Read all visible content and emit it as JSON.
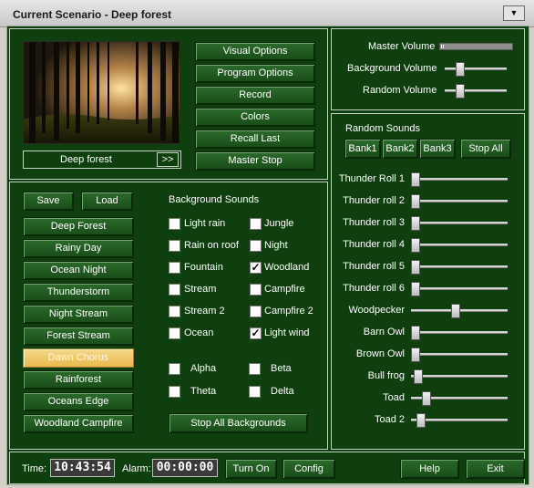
{
  "window": {
    "title": "Current Scenario - Deep forest",
    "dropdown_icon": "chevron-down-icon"
  },
  "preview": {
    "scene_name": "Deep forest",
    "next_label": ">>",
    "buttons": [
      "Visual Options",
      "Program Options",
      "Record",
      "Colors",
      "Recall Last",
      "Master Stop"
    ]
  },
  "volume": {
    "master_label": "Master Volume",
    "master_level_percent": 5,
    "background_label": "Background Volume",
    "background_level_percent": 20,
    "random_label": "Random Volume",
    "random_level_percent": 20
  },
  "presets": {
    "save_label": "Save",
    "load_label": "Load",
    "items": [
      "Deep Forest",
      "Rainy Day",
      "Ocean Night",
      "Thunderstorm",
      "Night Stream",
      "Forest Stream",
      "Dawn Chorus",
      "Rainforest",
      "Oceans Edge",
      "Woodland Campfire"
    ],
    "selected": "Dawn Chorus"
  },
  "background_sounds": {
    "heading": "Background Sounds",
    "left": [
      {
        "label": "Light rain",
        "checked": false
      },
      {
        "label": "Rain on roof",
        "checked": false
      },
      {
        "label": "Fountain",
        "checked": false
      },
      {
        "label": "Stream",
        "checked": false
      },
      {
        "label": "Stream 2",
        "checked": false
      },
      {
        "label": "Ocean",
        "checked": false
      }
    ],
    "right": [
      {
        "label": "Jungle",
        "checked": false
      },
      {
        "label": "Night",
        "checked": false
      },
      {
        "label": "Woodland",
        "checked": true
      },
      {
        "label": "Campfire",
        "checked": false
      },
      {
        "label": "Campfire 2",
        "checked": false
      },
      {
        "label": "Light wind",
        "checked": true
      }
    ],
    "waves": [
      {
        "label": "Alpha",
        "checked": false
      },
      {
        "label": "Beta",
        "checked": false
      },
      {
        "label": "Theta",
        "checked": false
      },
      {
        "label": "Delta",
        "checked": false
      }
    ],
    "stop_all_label": "Stop All Backgrounds"
  },
  "random_sounds": {
    "heading": "Random Sounds",
    "bank_buttons": [
      "Bank1",
      "Bank2",
      "Bank3"
    ],
    "stop_all_label": "Stop All",
    "sliders": [
      {
        "label": "Thunder Roll 1",
        "level_percent": 0
      },
      {
        "label": "Thunder roll 2",
        "level_percent": 0
      },
      {
        "label": "Thunder roll 3",
        "level_percent": 0
      },
      {
        "label": "Thunder roll 4",
        "level_percent": 0
      },
      {
        "label": "Thunder roll 5",
        "level_percent": 0
      },
      {
        "label": "Thunder roll 6",
        "level_percent": 0
      },
      {
        "label": "Woodpecker",
        "level_percent": 46
      },
      {
        "label": "Barn Owl",
        "level_percent": 0
      },
      {
        "label": "Brown Owl",
        "level_percent": 0
      },
      {
        "label": "Bull frog",
        "level_percent": 3
      },
      {
        "label": "Toad",
        "level_percent": 12
      },
      {
        "label": "Toad 2",
        "level_percent": 6
      }
    ]
  },
  "status": {
    "time_label": "Time:",
    "time_value": "10:43:54",
    "alarm_label": "Alarm:",
    "alarm_value": "00:00:00",
    "turn_on_label": "Turn On",
    "config_label": "Config",
    "help_label": "Help",
    "exit_label": "Exit"
  }
}
